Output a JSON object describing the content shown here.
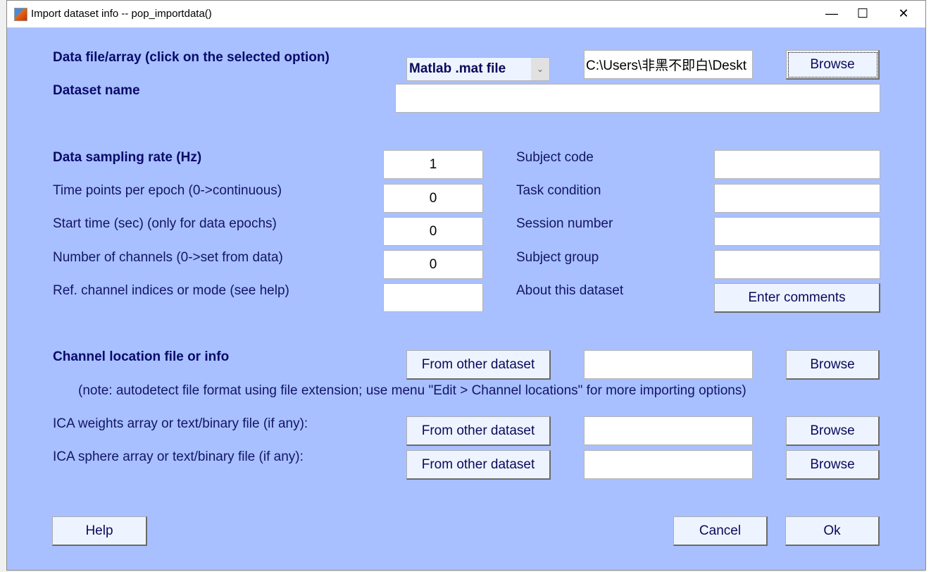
{
  "window": {
    "title": "Import dataset info -- pop_importdata()",
    "minimize": "—",
    "maximize": "☐",
    "close": "✕"
  },
  "data_file": {
    "label": "Data file/array (click on the selected option)",
    "format": "Matlab .mat file",
    "path": "C:\\Users\\非黑不即白\\Deskt",
    "browse": "Browse"
  },
  "dataset_name": {
    "label": "Dataset name",
    "value": ""
  },
  "left_fields": [
    {
      "label": "Data sampling rate (Hz)",
      "value": "1"
    },
    {
      "label": "Time points per epoch (0->continuous)",
      "value": "0"
    },
    {
      "label": "Start time (sec) (only for data epochs)",
      "value": "0"
    },
    {
      "label": "Number of channels (0->set from data)",
      "value": "0"
    },
    {
      "label": "Ref. channel indices or mode (see help)",
      "value": ""
    }
  ],
  "right_fields": [
    {
      "label": "Subject code",
      "value": ""
    },
    {
      "label": "Task condition",
      "value": ""
    },
    {
      "label": "Session number",
      "value": ""
    },
    {
      "label": "Subject group",
      "value": ""
    },
    {
      "label": "About this dataset",
      "button": "Enter comments"
    }
  ],
  "chanlocs": {
    "label": "Channel location file or info",
    "from_other": "From other dataset",
    "value": "",
    "browse": "Browse",
    "note": "(note: autodetect file format using file extension; use menu \"Edit > Channel locations\" for more importing options)"
  },
  "ica_weights": {
    "label": "ICA weights array or text/binary file (if any):",
    "from_other": "From other dataset",
    "value": "",
    "browse": "Browse"
  },
  "ica_sphere": {
    "label": "ICA sphere array or text/binary file (if any):",
    "from_other": "From other dataset",
    "value": "",
    "browse": "Browse"
  },
  "footer": {
    "help": "Help",
    "cancel": "Cancel",
    "ok": "Ok"
  },
  "colors": {
    "background": "#a8c0ff",
    "label_text": "#0a0a6a"
  }
}
